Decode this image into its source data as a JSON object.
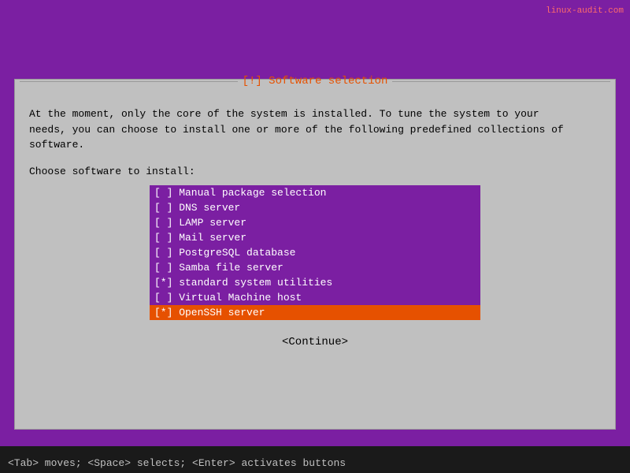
{
  "watermark": "linux-audit.com",
  "dialog": {
    "title": "[!] Software selection",
    "description_line1": "At the moment, only the core of the system is installed. To tune the system to your",
    "description_line2": "needs, you can choose to install one or more of the following predefined collections of",
    "description_line3": "software.",
    "choose_label": "Choose software to install:",
    "items": [
      {
        "id": "manual",
        "checkbox": "[ ]",
        "label": "Manual package selection",
        "selected": false,
        "highlighted": false
      },
      {
        "id": "dns",
        "checkbox": "[ ]",
        "label": "DNS server",
        "selected": false,
        "highlighted": false
      },
      {
        "id": "lamp",
        "checkbox": "[ ]",
        "label": "LAMP server",
        "selected": false,
        "highlighted": false
      },
      {
        "id": "mail",
        "checkbox": "[ ]",
        "label": "Mail server",
        "selected": false,
        "highlighted": false
      },
      {
        "id": "postgresql",
        "checkbox": "[ ]",
        "label": "PostgreSQL database",
        "selected": false,
        "highlighted": false
      },
      {
        "id": "samba",
        "checkbox": "[ ]",
        "label": "Samba file server",
        "selected": false,
        "highlighted": false
      },
      {
        "id": "standard",
        "checkbox": "[*]",
        "label": "standard system utilities",
        "selected": true,
        "highlighted": false
      },
      {
        "id": "vm",
        "checkbox": "[ ]",
        "label": "Virtual Machine host",
        "selected": false,
        "highlighted": false
      },
      {
        "id": "openssh",
        "checkbox": "[*]",
        "label": "OpenSSH server",
        "selected": true,
        "highlighted": true
      }
    ],
    "continue_label": "<Continue>"
  },
  "status_bar": {
    "text": "<Tab> moves; <Space> selects; <Enter> activates buttons"
  }
}
